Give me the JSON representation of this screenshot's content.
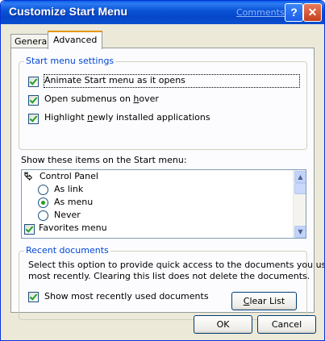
{
  "window": {
    "title": "Customize Start Menu",
    "link": "Comments?"
  },
  "tabs": [
    {
      "label": "General"
    },
    {
      "label": "Advanced"
    }
  ],
  "start_menu_settings": {
    "label": "Start menu settings",
    "options": [
      {
        "pre": "",
        "u": "",
        "post": "Animate Start menu as it opens",
        "checked": true
      },
      {
        "pre": "Open submenus on ",
        "u": "h",
        "post": "over",
        "checked": true
      },
      {
        "pre": "Highlight ",
        "u": "n",
        "post": "ewly installed applications",
        "checked": true
      }
    ]
  },
  "items_list": {
    "label": "Show these items on the Start menu:",
    "items": [
      {
        "type": "header",
        "label": "Control Panel"
      },
      {
        "type": "radio",
        "label": "As link",
        "selected": false
      },
      {
        "type": "radio",
        "label": "As menu",
        "selected": true
      },
      {
        "type": "radio",
        "label": "Never",
        "selected": false
      },
      {
        "type": "checkbox",
        "label": "Favorites menu",
        "checked": true
      }
    ]
  },
  "recent_documents": {
    "label": "Recent documents",
    "description_line1": "Select this option to provide quick access to the documents you used",
    "description_line2": "most recently.  Clearing this list does not delete the documents.",
    "checkbox_label": "Show most recently used documents",
    "clear_button": {
      "pre": "",
      "u": "C",
      "post": "lear List"
    }
  },
  "buttons": {
    "ok": "OK",
    "cancel": "Cancel"
  }
}
